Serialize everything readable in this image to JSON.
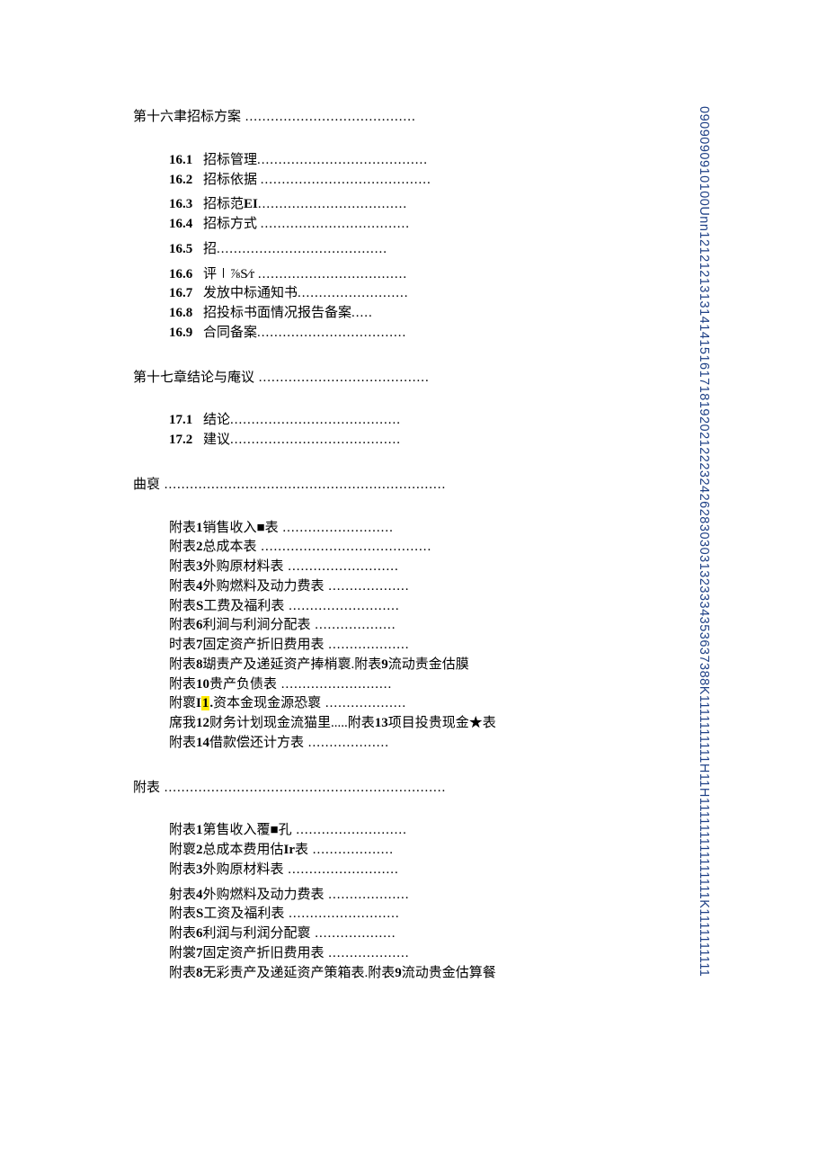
{
  "chapter16": {
    "title": "第十六聿招标方案",
    "items": [
      {
        "num": "16.1",
        "text": "招标管理"
      },
      {
        "num": "16.2",
        "text": "招标依据"
      },
      {
        "num": "16.3",
        "text": "招标范EI"
      },
      {
        "num": "16.4",
        "text": "招标方式"
      },
      {
        "num": "16.5",
        "text": "招"
      },
      {
        "num": "16.6",
        "text": "评∣⅞S∕r"
      },
      {
        "num": "16.7",
        "text": "发放中标通知书"
      },
      {
        "num": "16.8",
        "text": "招投标书面情况报告备案"
      },
      {
        "num": "16.9",
        "text": "合同备案"
      }
    ]
  },
  "chapter17": {
    "title": "第十七章结论与庵议",
    "items": [
      {
        "num": "17.1",
        "text": "结论"
      },
      {
        "num": "17.2",
        "text": "建议"
      }
    ]
  },
  "appendixA": {
    "title": "曲裒",
    "items": [
      "附表1销售收入■表",
      "附表2总成本表",
      "附表3外购原材料表",
      "附表4外购燃料及动力费表",
      "附表S工费及福利表",
      "附表6利涧与利涧分配表",
      "时表7固定资产折旧费用表",
      "附表8瑚责产及递延资产捧梢褱.附表9流动责金估膜",
      "附表10贵产负债表",
      "附褱I1.资本金现金源恐褱",
      "席我12财务计划现金流猫里.....附表13项目投贵现金★表",
      "附表14借款偿还计方表"
    ],
    "highlight_index": 9
  },
  "appendixB": {
    "title": "附表",
    "items": [
      "附表1第售收入覆■孔",
      "附褱2总成本费用估Ir表",
      "附表3外购原材料表",
      "射表4外购燃料及动力费表",
      "附表S工资及福利表",
      "附表6利润与利润分配褱",
      "附裳7固定资产折旧费用表",
      "附表8无彩责产及递延资产策箱表.附表9流动贵金估算餐"
    ]
  },
  "leaders": {
    "long": " ........................................",
    "med": " ...................................",
    "short": " ..........................",
    "tiny": " ...................",
    "xl": " .................................................................."
  },
  "side_text": "0909090910100Unn12121213131414151617181920212223242628303031323334353637388K1111111111H11H111111111111111K1111111111"
}
